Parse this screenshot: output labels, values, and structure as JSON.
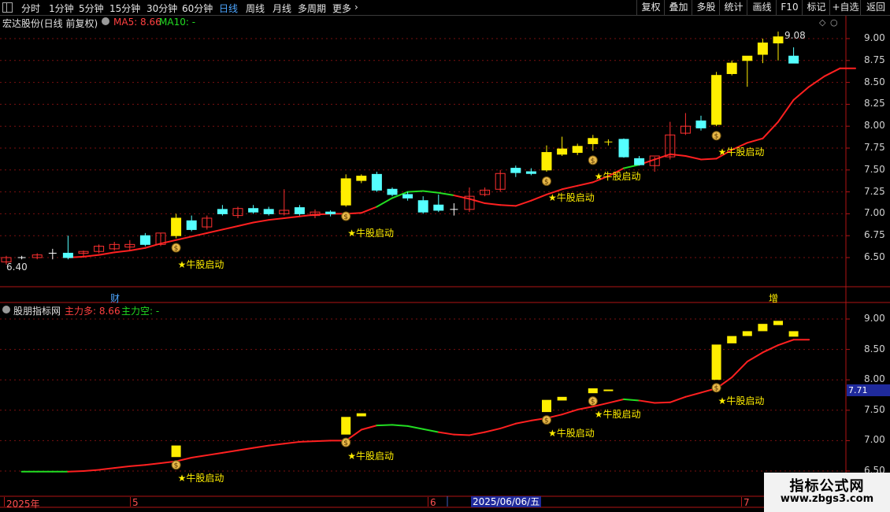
{
  "toolbar": {
    "periods": [
      "分时",
      "1分钟",
      "5分钟",
      "15分钟",
      "30分钟",
      "60分钟",
      "日线",
      "周线",
      "月线",
      "多周期",
      "更多"
    ],
    "active": "日线",
    "more_icon": "chevron-right-icon",
    "right_buttons": [
      "复权",
      "叠加",
      "多股",
      "统计",
      "画线",
      "F10",
      "标记",
      "+自选",
      "返回"
    ]
  },
  "main_panel": {
    "title": "宏达股份(日线 前复权)",
    "ma5_label": "MA5: 8.66",
    "ma10_label": "MA10: -",
    "high_label": "9.08",
    "low_label": "6.40",
    "axis_ticks": [
      "9.00",
      "8.75",
      "8.50",
      "8.25",
      "8.00",
      "7.75",
      "7.50",
      "7.25",
      "7.00",
      "6.75",
      "6.50"
    ],
    "marker_cai": "财",
    "marker_zeng": "增"
  },
  "sub_panel": {
    "title": "股朋指标网",
    "bull_label": "主力多: 8.66",
    "bear_label": "主力空: -",
    "axis_ticks": [
      "9.00",
      "8.50",
      "8.00",
      "7.50",
      "7.00",
      "6.50"
    ],
    "current_value": "7.71"
  },
  "signals": {
    "text": "★牛股启动",
    "icon": "money-bag-icon"
  },
  "date_axis": {
    "labels": [
      "2025年",
      "5",
      "6",
      "7"
    ],
    "cursor_label": "2025/06/06/五"
  },
  "watermark": {
    "title": "指标公式网",
    "url": "www.zbgs3.com"
  },
  "colors": {
    "up_yellow": "#ffee00",
    "down_cyan": "#55ffff",
    "rise_red": "#ff3030",
    "ma_red": "#ff2020",
    "bear_green": "#22dd22",
    "frame": "#b01515"
  },
  "chart_data": {
    "type": "candlestick",
    "candles": [
      {
        "o": 6.45,
        "h": 6.52,
        "l": 6.42,
        "c": 6.5,
        "st": "red"
      },
      {
        "o": 6.5,
        "h": 6.52,
        "l": 6.48,
        "c": 6.5,
        "st": "cross"
      },
      {
        "o": 6.5,
        "h": 6.55,
        "l": 6.48,
        "c": 6.53,
        "st": "red"
      },
      {
        "o": 6.55,
        "h": 6.6,
        "l": 6.48,
        "c": 6.54,
        "st": "cross"
      },
      {
        "o": 6.55,
        "h": 6.75,
        "l": 6.48,
        "c": 6.5,
        "st": "cyan"
      },
      {
        "o": 6.55,
        "h": 6.58,
        "l": 6.5,
        "c": 6.57,
        "st": "red"
      },
      {
        "o": 6.57,
        "h": 6.65,
        "l": 6.55,
        "c": 6.63,
        "st": "red"
      },
      {
        "o": 6.6,
        "h": 6.68,
        "l": 6.58,
        "c": 6.65,
        "st": "red"
      },
      {
        "o": 6.62,
        "h": 6.7,
        "l": 6.58,
        "c": 6.65,
        "st": "red"
      },
      {
        "o": 6.75,
        "h": 6.78,
        "l": 6.63,
        "c": 6.65,
        "st": "cyan"
      },
      {
        "o": 6.65,
        "h": 6.78,
        "l": 6.63,
        "c": 6.78,
        "st": "red"
      },
      {
        "o": 6.75,
        "h": 7.0,
        "l": 6.72,
        "c": 6.95,
        "st": "yellow",
        "signal": true
      },
      {
        "o": 6.92,
        "h": 6.98,
        "l": 6.8,
        "c": 6.82,
        "st": "cyan"
      },
      {
        "o": 6.85,
        "h": 6.98,
        "l": 6.82,
        "c": 6.95,
        "st": "red"
      },
      {
        "o": 7.05,
        "h": 7.1,
        "l": 6.98,
        "c": 7.0,
        "st": "cyan"
      },
      {
        "o": 6.98,
        "h": 7.08,
        "l": 6.95,
        "c": 7.06,
        "st": "red"
      },
      {
        "o": 7.06,
        "h": 7.1,
        "l": 7.0,
        "c": 7.02,
        "st": "cyan"
      },
      {
        "o": 7.05,
        "h": 7.08,
        "l": 6.98,
        "c": 7.0,
        "st": "cyan"
      },
      {
        "o": 7.0,
        "h": 7.28,
        "l": 6.98,
        "c": 7.04,
        "st": "red"
      },
      {
        "o": 7.07,
        "h": 7.1,
        "l": 6.98,
        "c": 7.0,
        "st": "cyan"
      },
      {
        "o": 6.98,
        "h": 7.05,
        "l": 6.95,
        "c": 7.02,
        "st": "red"
      },
      {
        "o": 7.02,
        "h": 7.04,
        "l": 6.97,
        "c": 7.0,
        "st": "cyan"
      },
      {
        "o": 7.1,
        "h": 7.45,
        "l": 7.08,
        "c": 7.4,
        "st": "yellow",
        "signal": true
      },
      {
        "o": 7.38,
        "h": 7.45,
        "l": 7.35,
        "c": 7.43,
        "st": "yellow"
      },
      {
        "o": 7.45,
        "h": 7.48,
        "l": 7.25,
        "c": 7.27,
        "st": "cyan"
      },
      {
        "o": 7.28,
        "h": 7.3,
        "l": 7.2,
        "c": 7.22,
        "st": "cyan"
      },
      {
        "o": 7.22,
        "h": 7.25,
        "l": 7.15,
        "c": 7.18,
        "st": "cyan"
      },
      {
        "o": 7.15,
        "h": 7.2,
        "l": 7.0,
        "c": 7.02,
        "st": "cyan"
      },
      {
        "o": 7.1,
        "h": 7.22,
        "l": 7.02,
        "c": 7.04,
        "st": "cyan"
      },
      {
        "o": 7.05,
        "h": 7.12,
        "l": 6.98,
        "c": 7.05,
        "st": "cross_w"
      },
      {
        "o": 7.05,
        "h": 7.3,
        "l": 7.02,
        "c": 7.2,
        "st": "red"
      },
      {
        "o": 7.22,
        "h": 7.3,
        "l": 7.2,
        "c": 7.27,
        "st": "red"
      },
      {
        "o": 7.28,
        "h": 7.5,
        "l": 7.25,
        "c": 7.46,
        "st": "red"
      },
      {
        "o": 7.47,
        "h": 7.55,
        "l": 7.42,
        "c": 7.52,
        "st": "cyan"
      },
      {
        "o": 7.48,
        "h": 7.52,
        "l": 7.44,
        "c": 7.46,
        "st": "cyan"
      },
      {
        "o": 7.5,
        "h": 7.78,
        "l": 7.48,
        "c": 7.7,
        "st": "yellow",
        "signal": true
      },
      {
        "o": 7.68,
        "h": 7.88,
        "l": 7.66,
        "c": 7.74,
        "st": "yellow"
      },
      {
        "o": 7.77,
        "h": 7.8,
        "l": 7.67,
        "c": 7.7,
        "st": "yellow"
      },
      {
        "o": 7.8,
        "h": 7.9,
        "l": 7.72,
        "c": 7.86,
        "st": "yellow",
        "signal": true
      },
      {
        "o": 7.82,
        "h": 7.85,
        "l": 7.78,
        "c": 7.82,
        "st": "cross_y"
      },
      {
        "o": 7.85,
        "h": 7.86,
        "l": 7.64,
        "c": 7.65,
        "st": "cyan"
      },
      {
        "o": 7.63,
        "h": 7.66,
        "l": 7.55,
        "c": 7.56,
        "st": "cyan"
      },
      {
        "o": 7.55,
        "h": 7.65,
        "l": 7.48,
        "c": 7.66,
        "st": "red"
      },
      {
        "o": 7.65,
        "h": 8.05,
        "l": 7.62,
        "c": 7.9,
        "st": "red"
      },
      {
        "o": 7.92,
        "h": 8.15,
        "l": 7.9,
        "c": 8.0,
        "st": "red"
      },
      {
        "o": 7.98,
        "h": 8.12,
        "l": 7.95,
        "c": 8.06,
        "st": "cyan"
      },
      {
        "o": 8.02,
        "h": 8.62,
        "l": 8.0,
        "c": 8.58,
        "st": "yellow",
        "signal": true
      },
      {
        "o": 8.6,
        "h": 8.75,
        "l": 8.58,
        "c": 8.72,
        "st": "yellow"
      },
      {
        "o": 8.75,
        "h": 8.8,
        "l": 8.45,
        "c": 8.8,
        "st": "yellow"
      },
      {
        "o": 8.82,
        "h": 9.0,
        "l": 8.72,
        "c": 8.95,
        "st": "yellow"
      },
      {
        "o": 8.95,
        "h": 9.08,
        "l": 8.75,
        "c": 9.02,
        "st": "yellow"
      },
      {
        "o": 8.8,
        "h": 8.9,
        "l": 8.72,
        "c": 8.72,
        "st": "cyan"
      }
    ],
    "ma_x_start": 4,
    "ma_y": [
      6.5,
      6.51,
      6.53,
      6.56,
      6.58,
      6.61,
      6.66,
      6.7,
      6.74,
      6.78,
      6.82,
      6.86,
      6.9,
      6.93,
      6.95,
      6.97,
      6.99,
      7.0,
      7.0,
      7.01,
      7.08,
      7.18,
      7.25,
      7.26,
      7.24,
      7.21,
      7.17,
      7.12,
      7.1,
      7.09,
      7.15,
      7.22,
      7.28,
      7.32,
      7.36,
      7.43,
      7.52,
      7.56,
      7.62,
      7.68,
      7.66,
      7.62,
      7.63,
      7.73,
      7.81,
      7.86,
      8.05,
      8.3,
      8.45,
      8.57,
      8.66,
      8.66
    ],
    "ma_green_ranges": [
      [
        24,
        29
      ],
      [
        40,
        41
      ]
    ],
    "sub_ma_start": 1,
    "sub_ma_y": [
      6.49,
      6.49,
      6.49,
      6.49,
      6.5,
      6.52,
      6.55,
      6.58,
      6.6,
      6.63,
      6.66,
      6.72,
      6.76,
      6.8,
      6.84,
      6.88,
      6.92,
      6.95,
      6.98,
      6.99,
      7.0,
      7.0,
      7.18,
      7.25,
      7.26,
      7.24,
      7.19,
      7.14,
      7.1,
      7.09,
      7.14,
      7.2,
      7.28,
      7.33,
      7.37,
      7.43,
      7.51,
      7.56,
      7.62,
      7.68,
      7.66,
      7.62,
      7.63,
      7.72,
      7.79,
      7.86,
      8.04,
      8.3,
      8.45,
      8.57,
      8.66,
      8.66
    ],
    "sub_green_ranges": [
      [
        0,
        4
      ],
      [
        24,
        28
      ],
      [
        40,
        41
      ]
    ],
    "sub_bars": [
      {
        "i": 11,
        "top": 6.92,
        "bot": 6.73
      },
      {
        "i": 22,
        "top": 7.39,
        "bot": 7.1
      },
      {
        "i": 23,
        "top": 7.45,
        "bot": 7.4
      },
      {
        "i": 35,
        "top": 7.67,
        "bot": 7.47
      },
      {
        "i": 36,
        "top": 7.72,
        "bot": 7.66
      },
      {
        "i": 38,
        "top": 7.86,
        "bot": 7.78
      },
      {
        "i": 39,
        "top": 7.84,
        "bot": 7.83
      },
      {
        "i": 46,
        "top": 8.58,
        "bot": 8.0
      },
      {
        "i": 47,
        "top": 8.72,
        "bot": 8.6
      },
      {
        "i": 48,
        "top": 8.8,
        "bot": 8.72
      },
      {
        "i": 49,
        "top": 8.92,
        "bot": 8.8
      },
      {
        "i": 50,
        "top": 8.97,
        "bot": 8.9
      },
      {
        "i": 51,
        "top": 8.8,
        "bot": 8.71
      }
    ],
    "signal_indices": [
      11,
      22,
      35,
      38,
      46
    ],
    "main_range": [
      6.3,
      9.15
    ],
    "sub_range": [
      6.5,
      9.15
    ]
  }
}
